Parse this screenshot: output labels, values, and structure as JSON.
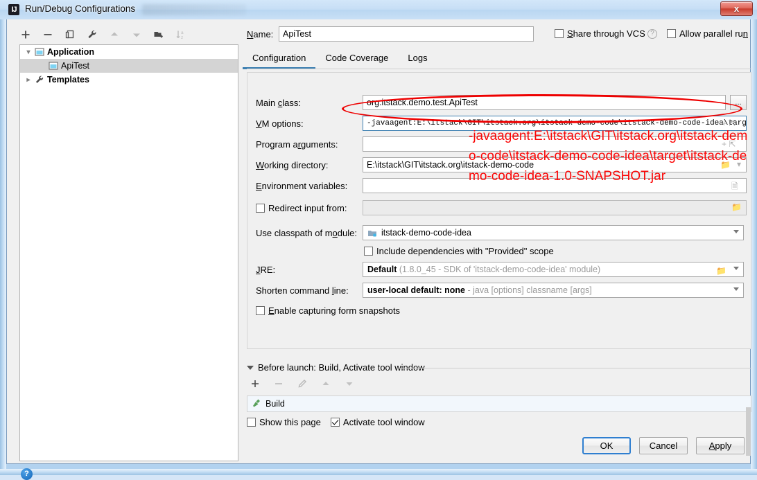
{
  "window": {
    "title": "Run/Debug Configurations",
    "icon": "intellij-idea-icon",
    "close_label": "x"
  },
  "toolbar": {
    "icons": [
      "add-icon",
      "remove-icon",
      "copy-icon",
      "edit-templates-icon",
      "move-up-icon",
      "move-down-icon",
      "move-into-folder-icon",
      "sort-alphabetically-icon"
    ]
  },
  "tree": {
    "nodes": [
      {
        "label": "Application",
        "type": "group",
        "expanded": true,
        "selected": false
      },
      {
        "label": "ApiTest",
        "type": "config",
        "expanded": false,
        "selected": true
      },
      {
        "label": "Templates",
        "type": "templates",
        "expanded": false,
        "selected": false
      }
    ]
  },
  "help": {
    "label": "?"
  },
  "header": {
    "name_label": "Name:",
    "name_value": "ApiTest",
    "name_placeholder": "",
    "share_vcs_label": "Share through VCS",
    "share_vcs_checked": false,
    "vcs_help_label": "?",
    "allow_parallel_label": "Allow parallel run",
    "allow_parallel_checked": false
  },
  "tabs": [
    {
      "label": "Configuration",
      "active": true
    },
    {
      "label": "Code Coverage",
      "active": false
    },
    {
      "label": "Logs",
      "active": false
    }
  ],
  "form": {
    "main_class": {
      "label": "Main class:",
      "value": "org.itstack.demo.test.ApiTest",
      "browse_label": "..."
    },
    "vm_options": {
      "label": "VM options:",
      "value": "-javaagent:E:\\itstack\\GIT\\itstack.org\\itstack-demo-code\\itstack-demo-code-idea\\targ",
      "expand_icons": "+ ⤡",
      "focused": true
    },
    "program_arguments": {
      "label": "Program arguments:",
      "value": "",
      "expand_icons": "+ ⤡"
    },
    "working_directory": {
      "label": "Working directory:",
      "value": "E:\\itstack\\GIT\\itstack.org\\itstack-demo-code",
      "browse_icon": "folder-icon",
      "history_icon": "chevron-down-icon"
    },
    "environment_variables": {
      "label": "Environment variables:",
      "value": "",
      "browse_icon": "environment-icon"
    },
    "redirect_input": {
      "label": "Redirect input from:",
      "checked": false,
      "value": "",
      "browse_icon": "folder-icon",
      "disabled": true
    },
    "use_classpath": {
      "label": "Use classpath of module:",
      "value": "itstack-demo-code-idea",
      "icon": "module-icon"
    },
    "include_provided": {
      "label": "Include dependencies with \"Provided\" scope",
      "checked": false
    },
    "jre": {
      "label": "JRE:",
      "value_bold": "Default",
      "value_hint": "(1.8.0_45 - SDK of 'itstack-demo-code-idea' module)",
      "browse_icon": "folder-icon"
    },
    "shorten_command_line": {
      "label": "Shorten command line:",
      "value_bold": "user-local default: none",
      "value_hint": "- java [options] classname [args]"
    },
    "enable_snapshots": {
      "label": "Enable capturing form snapshots",
      "checked": false
    }
  },
  "before_launch": {
    "header": "Before launch: Build, Activate tool window",
    "toolbar_icons": [
      "add-icon",
      "remove-icon",
      "edit-icon",
      "move-up-icon",
      "move-down-icon"
    ],
    "items": [
      {
        "label": "Build",
        "icon": "build-hammer-icon"
      }
    ],
    "show_page": {
      "label": "Show this page",
      "checked": false
    },
    "activate_tool_window": {
      "label": "Activate tool window",
      "checked": true
    }
  },
  "buttons": {
    "ok": "OK",
    "cancel": "Cancel",
    "apply": "Apply"
  },
  "annotations": {
    "ellipse_target": "vm-options-field",
    "note_text": "-javaagent:E:\\itstack\\GIT\\itstack.org\\itstack-demo-code\\itstack-demo-code-idea\\target\\itstack-demo-code-idea-1.0-SNAPSHOT.jar",
    "color": "#fb0707"
  }
}
